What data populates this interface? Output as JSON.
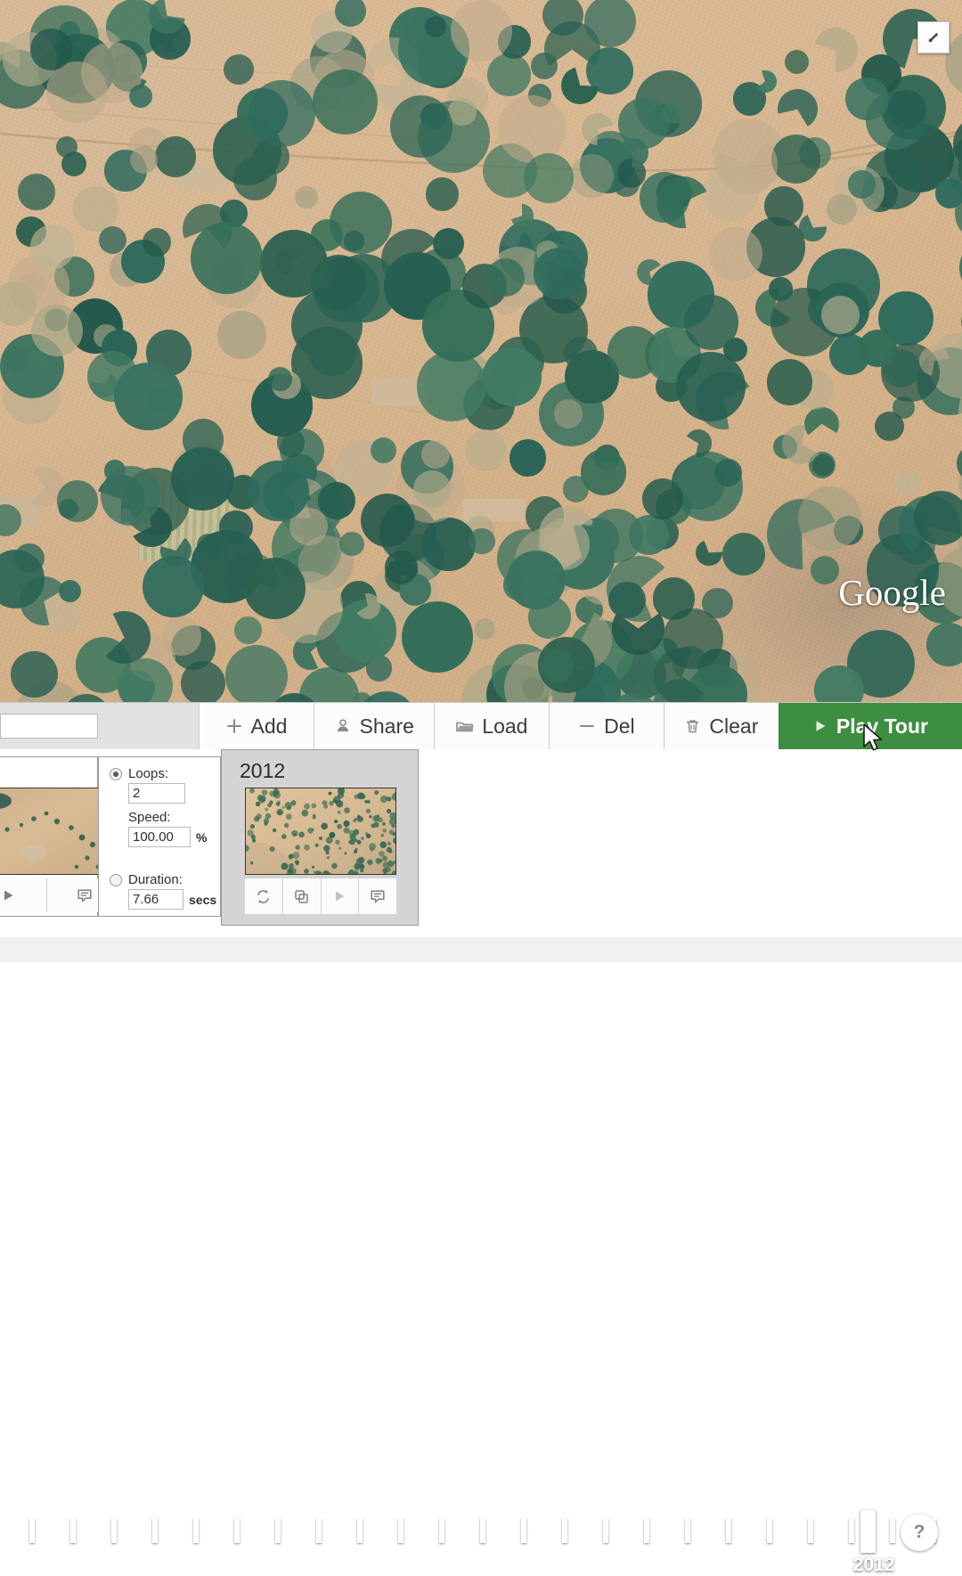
{
  "map": {
    "watermark": "Google",
    "watermark_sup": " ",
    "expand_icon": "expand-arrow-icon"
  },
  "timeline": {
    "active_year": "2012",
    "help_label": "?",
    "tick_count": 23,
    "first_tick_x": 33,
    "tick_spacing": 46,
    "active_tick_x": 966
  },
  "toolbar": {
    "search_value": "",
    "search_placeholder": "",
    "buttons": [
      {
        "label": "Add",
        "icon": "plus-icon",
        "name": "add-button"
      },
      {
        "label": "Share",
        "icon": "person-icon",
        "name": "share-button"
      },
      {
        "label": "Load",
        "icon": "folder-icon",
        "name": "load-button"
      },
      {
        "label": "Del",
        "icon": "minus-icon",
        "name": "delete-button"
      },
      {
        "label": "Clear",
        "icon": "trash-icon",
        "name": "clear-button"
      }
    ],
    "play_tour": {
      "label": "Play Tour",
      "icon": "play-icon",
      "color": "#3e8e41"
    }
  },
  "settings": {
    "loops": {
      "label": "Loops:",
      "value": "2",
      "selected": true
    },
    "speed": {
      "label": "Speed:",
      "value": "100.00",
      "unit": "%"
    },
    "duration": {
      "label": "Duration:",
      "value": "7.66",
      "unit": "secs",
      "selected": false
    }
  },
  "cards": [
    {
      "title": "",
      "name": "snapshot-card-partial",
      "buttons": [
        "play-icon",
        "comment-icon"
      ]
    },
    {
      "title": "2012",
      "name": "snapshot-card-2012",
      "buttons": [
        "loop-icon",
        "copy-icon",
        "play-icon",
        "comment-icon"
      ]
    }
  ],
  "colors": {
    "accent_green": "#3e8e41",
    "toolbar_bg": "#e2e2e2",
    "desert": "#d9b891",
    "crop_green": "#2f6b5e"
  }
}
